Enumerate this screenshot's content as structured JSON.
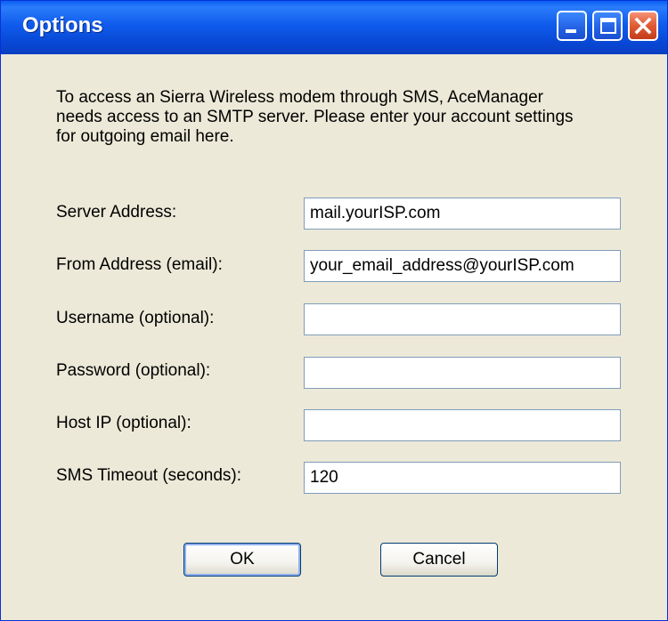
{
  "window": {
    "title": "Options",
    "title_buttons": {
      "minimize": "minimize-icon",
      "maximize": "maximize-icon",
      "close": "close-icon"
    }
  },
  "intro_text": "To access an Sierra Wireless modem through SMS, AceManager needs access to an SMTP server.  Please enter your account settings for outgoing email here.",
  "fields": [
    {
      "label": "Server Address:",
      "value": "mail.yourISP.com"
    },
    {
      "label": "From Address (email):",
      "value": "your_email_address@yourISP.com"
    },
    {
      "label": "Username (optional):",
      "value": ""
    },
    {
      "label": "Password (optional):",
      "value": ""
    },
    {
      "label": "Host IP (optional):",
      "value": ""
    },
    {
      "label": "SMS Timeout (seconds):",
      "value": "120"
    }
  ],
  "buttons": {
    "ok": "OK",
    "cancel": "Cancel"
  },
  "colors": {
    "title_bar": "#0a5ff0",
    "dialog_background": "#ece9d8",
    "close_button": "#e05a33"
  }
}
